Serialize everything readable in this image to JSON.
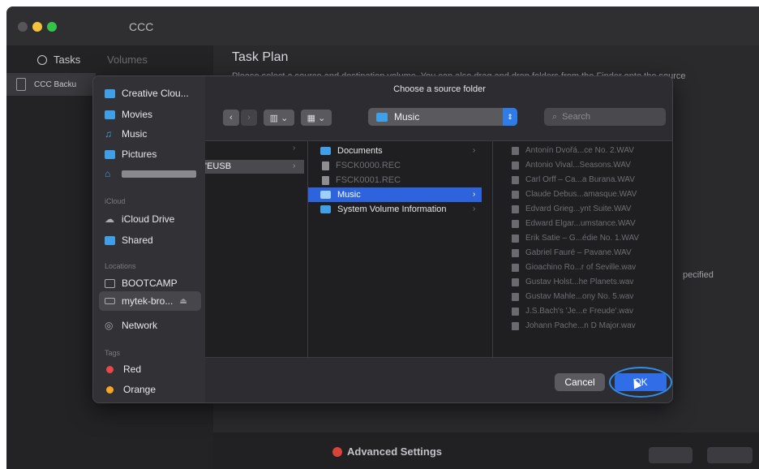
{
  "app": {
    "title": "CCC",
    "tasks_tab": "Tasks",
    "volumes_tab": "Volumes",
    "task_item": "CCC Backu",
    "task_plan": "Task Plan",
    "task_description": "Please select a source and destination volume. You can also drag and drop folders from the Finder onto the source",
    "specified_text": "pecified",
    "advanced_settings": "Advanced Settings"
  },
  "dialog": {
    "title": "Choose a source folder",
    "toolbar": {
      "path": "Music",
      "search_placeholder": "Search"
    },
    "sidebar": {
      "favorites": [
        {
          "label": "Creative Clou...",
          "icon": "document-icon",
          "color": "#3fa0e8"
        },
        {
          "label": "Movies",
          "icon": "film-icon",
          "color": "#3fa0e8"
        },
        {
          "label": "Music",
          "icon": "music-note-icon",
          "color": "#3fa0e8"
        },
        {
          "label": "Pictures",
          "icon": "photo-icon",
          "color": "#3fa0e8"
        },
        {
          "label": "",
          "icon": "home-icon",
          "color": "#3fa0e8"
        }
      ],
      "icloud_header": "iCloud",
      "icloud": [
        {
          "label": "iCloud Drive",
          "icon": "cloud-icon"
        },
        {
          "label": "Shared",
          "icon": "shared-folder-icon"
        }
      ],
      "locations_header": "Locations",
      "locations": [
        {
          "label": "BOOTCAMP",
          "icon": "disk-icon"
        },
        {
          "label": "mytek-bro...",
          "icon": "external-disk-icon",
          "eject": "⏏"
        },
        {
          "label": "Network",
          "icon": "globe-icon"
        }
      ],
      "tags_header": "Tags",
      "tags": [
        {
          "label": "Red",
          "color": "#e5484d"
        },
        {
          "label": "Orange",
          "color": "#f5a623"
        }
      ]
    },
    "columns": {
      "volume": "'EUSB",
      "folder_items": [
        {
          "label": "Documents",
          "type": "folder",
          "color": "#e6e5e9"
        },
        {
          "label": "FSCK0000.REC",
          "type": "file",
          "color": "#6f6e73"
        },
        {
          "label": "FSCK0001.REC",
          "type": "file",
          "color": "#6f6e73"
        },
        {
          "label": "Music",
          "type": "folder",
          "color": "#ffffff"
        },
        {
          "label": "System Volume Information",
          "type": "folder",
          "color": "#e6e5e9"
        }
      ],
      "files": [
        "Antonín Dvořá...ce No. 2.WAV",
        "Antonio Vival...Seasons.WAV",
        "Carl Orff – Ca...a Burana.WAV",
        "Claude Debus...amasque.WAV",
        "Edvard Grieg...ynt Suite.WAV",
        "Edward Elgar...umstance.WAV",
        "Erik Satie – G...édie No. 1.WAV",
        "Gabriel Fauré – Pavane.WAV",
        "Gioachino Ro...r of Seville.wav",
        "Gustav Holst...he Planets.wav",
        "Gustav Mahle...ony No. 5.wav",
        "J.S.Bach's 'Je...e Freude'.wav",
        "Johann Pache...n D Major.wav"
      ]
    },
    "buttons": {
      "cancel": "Cancel",
      "ok": "OK"
    }
  }
}
